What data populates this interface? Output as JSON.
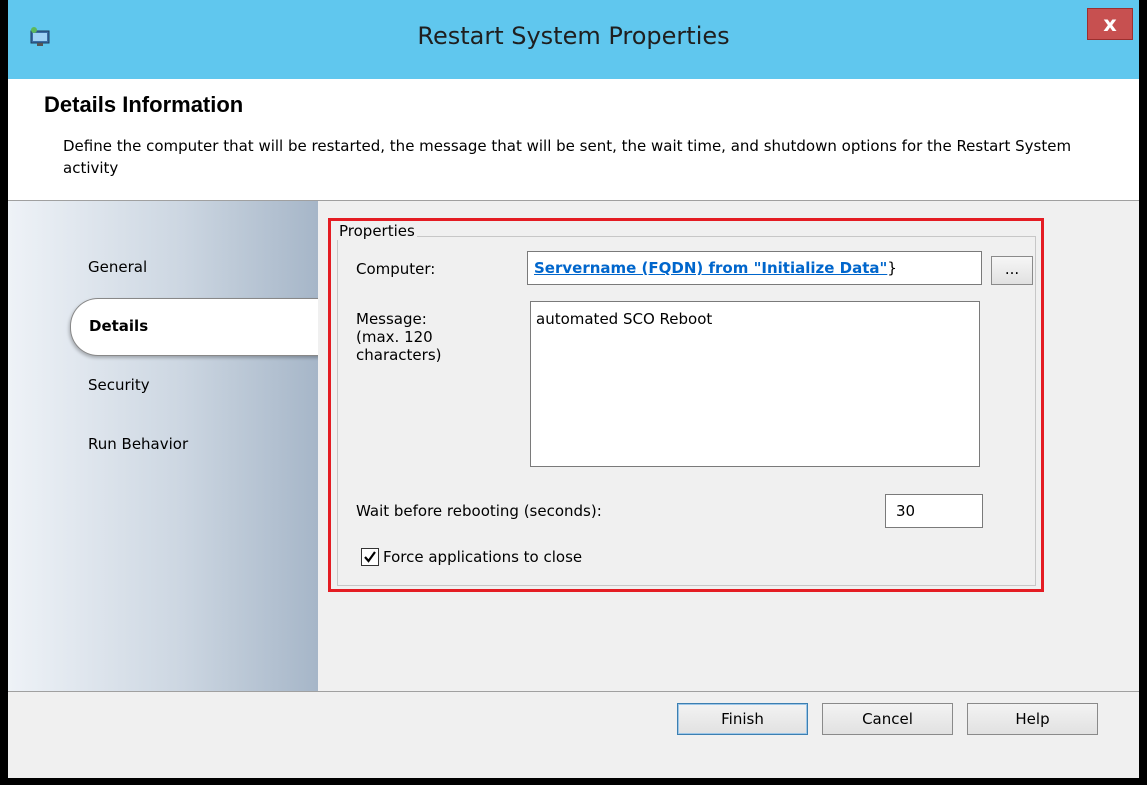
{
  "window": {
    "title": "Restart System Properties",
    "close_label": "x"
  },
  "header": {
    "title": "Details Information",
    "description": "Define the computer that will be restarted, the message that will be sent, the wait time, and shutdown options for the Restart System activity"
  },
  "nav": {
    "items": [
      {
        "label": "General"
      },
      {
        "label": "Details"
      },
      {
        "label": "Security"
      },
      {
        "label": "Run Behavior"
      }
    ],
    "selected": "Details"
  },
  "properties": {
    "group_label": "Properties",
    "computer_label": "Computer:",
    "computer_value": "Servername (FQDN) from \"Initialize Data\"",
    "computer_suffix": "}",
    "browse_label": "...",
    "message_label_line1": "Message:",
    "message_label_line2": "(max. 120",
    "message_label_line3": "characters)",
    "message_value": "automated SCO Reboot",
    "wait_label": "Wait before rebooting (seconds):",
    "wait_value": "30",
    "force_label": "Force applications to close",
    "force_checked": true
  },
  "buttons": {
    "finish": "Finish",
    "cancel": "Cancel",
    "help": "Help"
  },
  "colors": {
    "titlebar": "#60c7ee",
    "highlight": "#e41c23",
    "link": "#0066cc",
    "close": "#c75050"
  }
}
